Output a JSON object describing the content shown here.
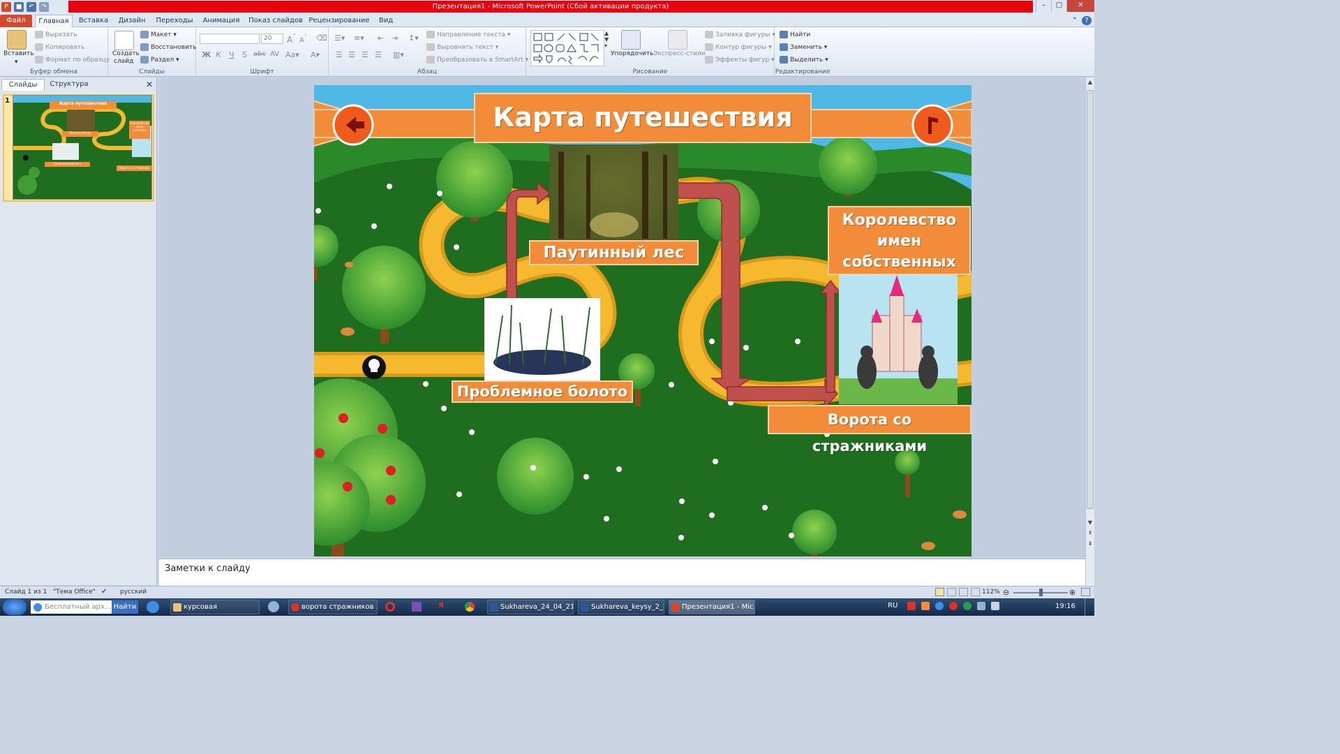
{
  "window": {
    "title": "Презентация1  -  Microsoft PowerPoint (Сбой активации продукта)"
  },
  "tabs": [
    "Файл",
    "Главная",
    "Вставка",
    "Дизайн",
    "Переходы",
    "Анимация",
    "Показ слайдов",
    "Рецензирование",
    "Вид"
  ],
  "ribbon": {
    "clipboard": {
      "label": "Буфер обмена",
      "paste": "Вставить",
      "cut": "Вырезать",
      "copy": "Копировать",
      "format": "Формат по образцу"
    },
    "slides": {
      "label": "Слайды",
      "new": "Создать",
      "new2": "слайд",
      "layout": "Макет",
      "reset": "Восстановить",
      "section": "Раздел"
    },
    "font": {
      "label": "Шрифт",
      "size": "20"
    },
    "paragraph": {
      "label": "Абзац",
      "direction": "Направление текста",
      "align": "Выровнять текст",
      "smartart": "Преобразовать в SmartArt"
    },
    "drawing": {
      "label": "Рисование",
      "arrange": "Упорядочить",
      "styles": "Экспресс-стили",
      "fill": "Заливка фигуры",
      "outline": "Контур фигуры",
      "effects": "Эффекты фигур"
    },
    "editing": {
      "label": "Редактирование",
      "find": "Найти",
      "replace": "Заменить",
      "select": "Выделить"
    }
  },
  "pane": {
    "tab_slides": "Слайды",
    "tab_outline": "Структура",
    "slide_number": "1"
  },
  "slide": {
    "title": "Карта путешествия",
    "forest": "Паутинный лес",
    "swamp": "Проблемное болото",
    "kingdom": "Королевство имен собственных",
    "gates": "Ворота со стражниками"
  },
  "thumb": {
    "title": "Карта путешествия",
    "forest": "Паутинный лес",
    "swamp": "Проблемноеболото",
    "kingdom": "Королевство имен собствен",
    "gates": "Ворота со стражник"
  },
  "notes": {
    "placeholder": "Заметки к слайду"
  },
  "status": {
    "slide": "Слайд 1 из 1",
    "theme": "\"Тема Office\"",
    "lang": "русский",
    "zoom": "112%"
  },
  "taskbar": {
    "search_placeholder": "Бесплатный арх...",
    "search_btn": "Найти",
    "items": [
      "курсовая",
      "ворота стражников ...",
      "Sukhareva_24_04_21....",
      "Sukhareva_keysy_2_k...",
      "Презентация1 - Mic..."
    ],
    "lang": "RU",
    "time": "19:16"
  },
  "colors": {
    "accent": "#d6482a",
    "banner": "#f28c38",
    "grass": "#1f6e1f",
    "path": "#f5b82e",
    "arrow": "#c0504d"
  }
}
